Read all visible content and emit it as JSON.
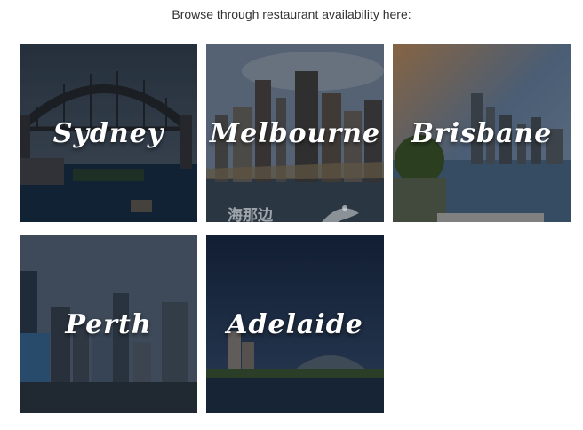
{
  "intro_text": "Browse through restaurant availability here:",
  "tiles": [
    {
      "city": "Sydney"
    },
    {
      "city": "Melbourne"
    },
    {
      "city": "Brisbane"
    },
    {
      "city": "Perth"
    },
    {
      "city": "Adelaide"
    }
  ],
  "watermark": {
    "text": "海那边"
  },
  "colors": {
    "text": "#333333",
    "overlay": "#000000",
    "city_text": "#ffffff"
  }
}
